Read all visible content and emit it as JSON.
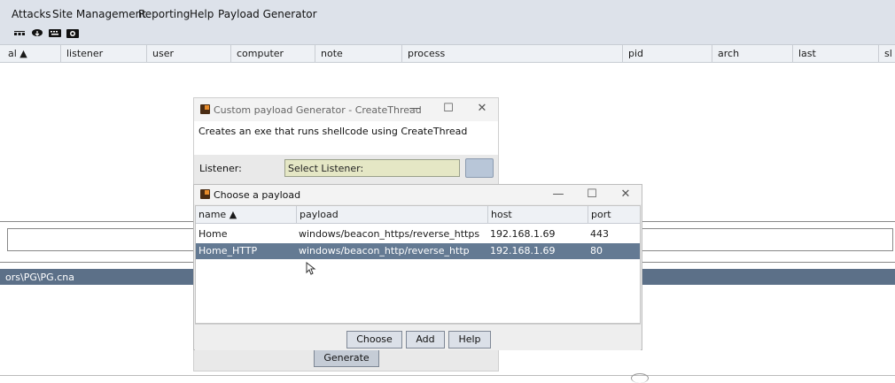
{
  "menubar": {
    "items": [
      "Attacks",
      "Site Management",
      "Reporting",
      "Help",
      "Payload Generator"
    ]
  },
  "toolbar": {
    "icons": [
      "connections-icon",
      "cloud-download-icon",
      "keyboard-icon",
      "screenshot-camera-icon"
    ]
  },
  "main_table": {
    "columns": [
      "al ▲",
      "listener",
      "user",
      "computer",
      "note",
      "process",
      "pid",
      "arch",
      "last",
      "sl"
    ]
  },
  "console": {
    "tab_path": "ors\\PG\\PG.cna"
  },
  "generator_window": {
    "title": "Custom payload Generator - CreateThread",
    "description": "Creates an exe that runs shellcode using CreateThread",
    "listener_label": "Listener:",
    "listener_value": "Select Listener:",
    "generate_label": "Generate",
    "controls": {
      "minimize": "—",
      "maximize": "☐",
      "close": "✕"
    }
  },
  "choose_dialog": {
    "title": "Choose a payload",
    "controls": {
      "minimize": "—",
      "maximize": "☐",
      "close": "✕"
    },
    "columns": [
      "name ▲",
      "payload",
      "host",
      "port"
    ],
    "rows": [
      {
        "name": "Home",
        "payload": "windows/beacon_https/reverse_https",
        "host": "192.168.1.69",
        "port": "443",
        "selected": false
      },
      {
        "name": "Home_HTTP",
        "payload": "windows/beacon_http/reverse_http",
        "host": "192.168.1.69",
        "port": "80",
        "selected": true
      }
    ],
    "buttons": {
      "choose": "Choose",
      "add": "Add",
      "help": "Help"
    }
  },
  "colors": {
    "menubar_bg": "#dde2ea",
    "selection_bg": "#647a93",
    "console_tab_bg": "#5c7088",
    "listener_field_bg": "#e5e7c5"
  }
}
